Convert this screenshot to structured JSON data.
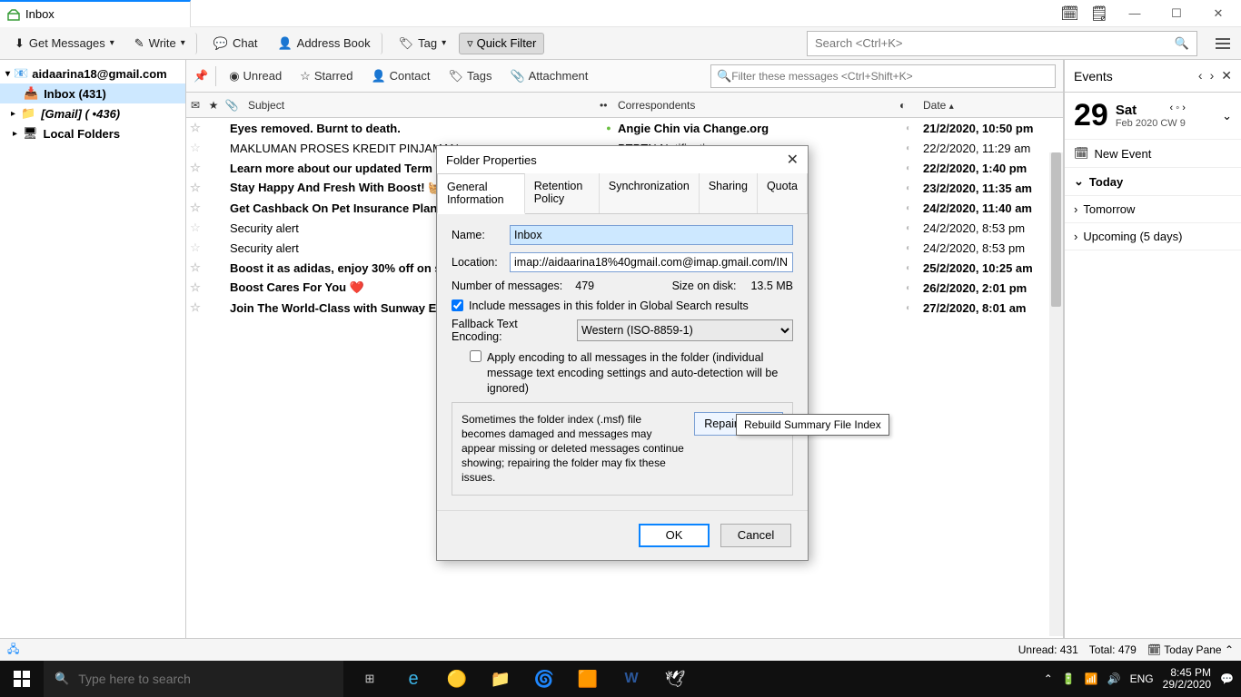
{
  "titlebar": {
    "tab_label": "Inbox"
  },
  "toolbar": {
    "get_messages": "Get Messages",
    "write": "Write",
    "chat": "Chat",
    "address_book": "Address Book",
    "tag": "Tag",
    "quick_filter": "Quick Filter",
    "search_placeholder": "Search <Ctrl+K>"
  },
  "folders": {
    "account": "aidaarina18@gmail.com",
    "inbox": "Inbox (431)",
    "gmail": "[Gmail] ( •436)",
    "local": "Local Folders"
  },
  "filterbar": {
    "unread": "Unread",
    "starred": "Starred",
    "contact": "Contact",
    "tags": "Tags",
    "attachment": "Attachment",
    "placeholder": "Filter these messages <Ctrl+Shift+K>"
  },
  "columns": {
    "subject": "Subject",
    "correspondents": "Correspondents",
    "date": "Date"
  },
  "messages": [
    {
      "bold": true,
      "subject": "Eyes removed. Burnt to death.",
      "dot": "green",
      "corr": "Angie Chin via Change.org",
      "date": "21/2/2020, 10:50 pm"
    },
    {
      "bold": false,
      "subject": "MAKLUMAN PROSES KREDIT PINJAMAN",
      "dot": "blue",
      "corr": "PTPTN Notification",
      "date": "22/2/2020, 11:29 am"
    },
    {
      "bold": true,
      "subject": "Learn more about our updated Term",
      "dot": "",
      "corr": "",
      "date": "22/2/2020, 1:40 pm"
    },
    {
      "bold": true,
      "subject": "Stay Happy And Fresh With Boost! 🧺",
      "dot": "",
      "corr": "",
      "date": "23/2/2020, 11:35 am"
    },
    {
      "bold": true,
      "subject": "Get Cashback On Pet Insurance Plan",
      "dot": "",
      "corr": "",
      "date": "24/2/2020, 11:40 am"
    },
    {
      "bold": false,
      "subject": "Security alert",
      "dot": "",
      "corr": "",
      "date": "24/2/2020, 8:53 pm"
    },
    {
      "bold": false,
      "subject": "Security alert",
      "dot": "",
      "corr": "",
      "date": "24/2/2020, 8:53 pm"
    },
    {
      "bold": true,
      "subject": "Boost it as adidas, enjoy 30% off on s",
      "dot": "",
      "corr": "",
      "date": "25/2/2020, 10:25 am"
    },
    {
      "bold": true,
      "subject": "Boost Cares For You ❤️",
      "dot": "",
      "corr": "",
      "date": "26/2/2020, 2:01 pm"
    },
    {
      "bold": true,
      "subject": "Join The World-Class with Sunway Ed",
      "dot": "",
      "corr": "",
      "date": "27/2/2020, 8:01 am"
    }
  ],
  "events": {
    "title": "Events",
    "num": "29",
    "day": "Sat",
    "sub": "Feb 2020  CW 9",
    "new_event": "New Event",
    "today": "Today",
    "tomorrow": "Tomorrow",
    "upcoming": "Upcoming (5 days)"
  },
  "status": {
    "unread": "Unread: 431",
    "total": "Total: 479",
    "today_pane": "Today Pane"
  },
  "dialog": {
    "title": "Folder Properties",
    "tabs": [
      "General Information",
      "Retention Policy",
      "Synchronization",
      "Sharing",
      "Quota"
    ],
    "name_lbl": "Name:",
    "name_val": "Inbox",
    "loc_lbl": "Location:",
    "loc_val": "imap://aidaarina18%40gmail.com@imap.gmail.com/IN",
    "nmsg_lbl": "Number of messages:",
    "nmsg_val": "479",
    "size_lbl": "Size on disk:",
    "size_val": "13.5 MB",
    "include": "Include messages in this folder in Global Search results",
    "fallback_lbl": "Fallback Text Encoding:",
    "fallback_val": "Western (ISO-8859-1)",
    "apply": "Apply encoding to all messages in the folder (individual message text encoding settings and auto-detection will be ignored)",
    "repair_info": "Sometimes the folder index (.msf) file becomes damaged and messages may appear missing or deleted messages continue showing; repairing the folder may fix these issues.",
    "repair_btn": "Repair Folder",
    "ok": "OK",
    "cancel": "Cancel",
    "tooltip": "Rebuild Summary File Index"
  },
  "taskbar": {
    "search_placeholder": "Type here to search",
    "lang": "ENG",
    "time": "8:45 PM",
    "date": "29/2/2020"
  }
}
